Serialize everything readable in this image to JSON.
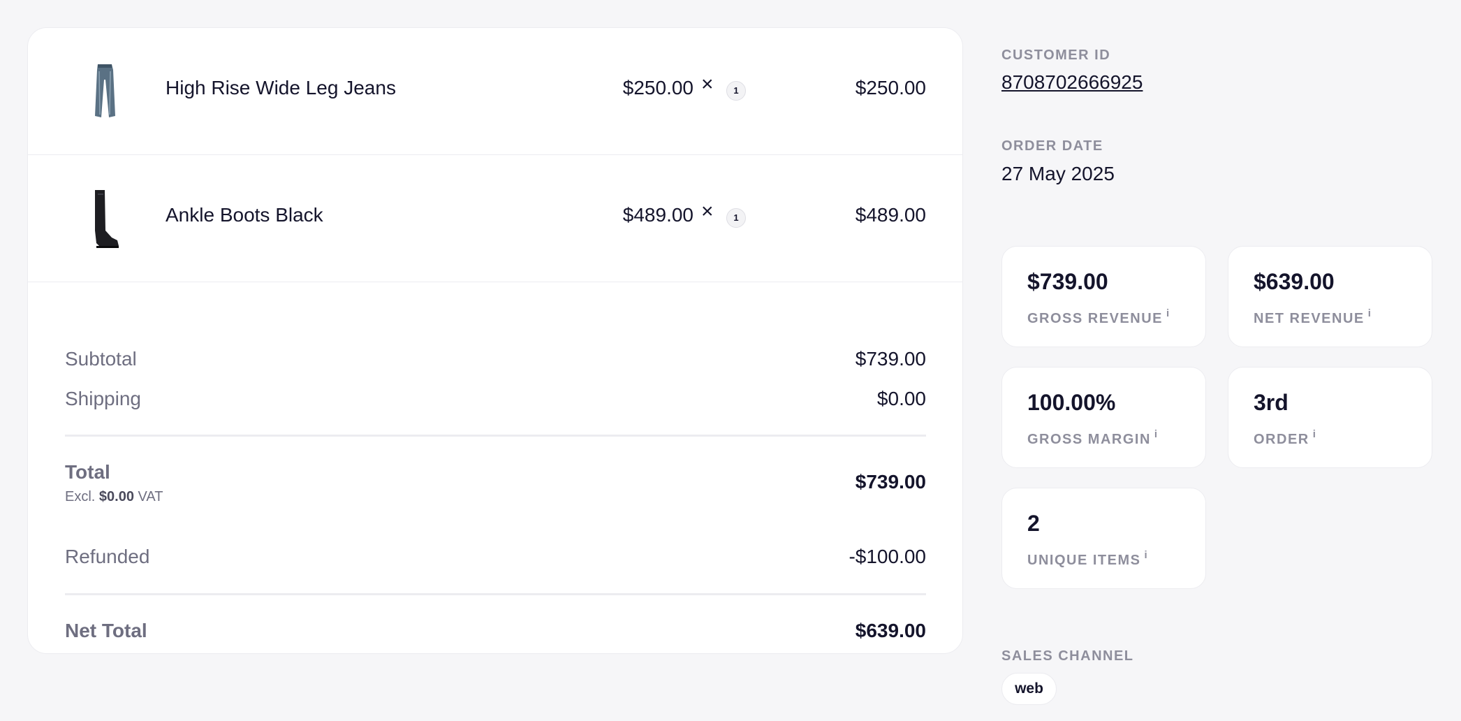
{
  "line_items": [
    {
      "name": "High Rise Wide Leg Jeans",
      "unit_price": "$250.00",
      "times": "×",
      "quantity": "1",
      "total": "$250.00",
      "thumb_icon": "jeans-icon"
    },
    {
      "name": "Ankle Boots Black",
      "unit_price": "$489.00",
      "times": "×",
      "quantity": "1",
      "total": "$489.00",
      "thumb_icon": "boot-icon"
    }
  ],
  "summary": {
    "subtotal_label": "Subtotal",
    "subtotal_value": "$739.00",
    "shipping_label": "Shipping",
    "shipping_value": "$0.00",
    "total_label": "Total",
    "total_value": "$739.00",
    "vat_prefix": "Excl.",
    "vat_amount": "$0.00",
    "vat_suffix": "VAT",
    "refunded_label": "Refunded",
    "refunded_value": "-$100.00",
    "net_total_label": "Net Total",
    "net_total_value": "$639.00"
  },
  "customer": {
    "label": "CUSTOMER ID",
    "id": "8708702666925"
  },
  "order_date": {
    "label": "ORDER DATE",
    "value": "27 May 2025"
  },
  "stats": [
    {
      "value": "$739.00",
      "label": "GROSS REVENUE",
      "info": "i"
    },
    {
      "value": "$639.00",
      "label": "NET REVENUE",
      "info": "i"
    },
    {
      "value": "100.00%",
      "label": "GROSS MARGIN",
      "info": "i"
    },
    {
      "value": "3rd",
      "label": "ORDER",
      "info": "i"
    },
    {
      "value": "2",
      "label": "UNIQUE ITEMS",
      "info": "i"
    }
  ],
  "sales_channel": {
    "label": "SALES CHANNEL",
    "value": "web"
  }
}
